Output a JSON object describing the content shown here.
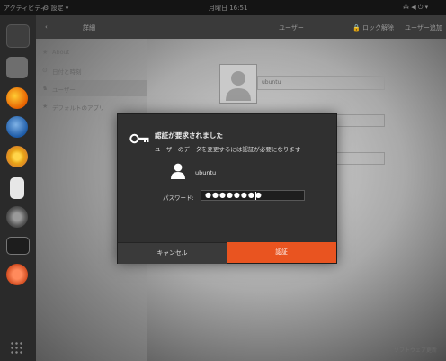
{
  "topbar": {
    "activities": "アクティビティ",
    "app_menu": "⚙ 設定 ▾",
    "clock": "月曜日 16:51",
    "status": "⁂ ◀ ⏻ ▾"
  },
  "settings_header": {
    "back": "‹",
    "section": "詳細",
    "title": "ユーザー",
    "unlock": "🔒 ロック解除",
    "add_user": "ユーザー追加"
  },
  "sidebar": {
    "items": [
      {
        "icon": "★",
        "label": "About"
      },
      {
        "icon": "⊙",
        "label": "日付と時刻"
      },
      {
        "icon": "♞",
        "label": "ユーザー"
      },
      {
        "icon": "★",
        "label": "デフォルトのアプリ"
      }
    ]
  },
  "user_panel": {
    "username": "ubuntu"
  },
  "watermark": "ソフトウェア更新",
  "dialog": {
    "title": "認証が要求されました",
    "subtitle": "ユーザーのデータを変更するには認証が必要になります",
    "user_name": "ubuntu",
    "password_label": "パスワード:",
    "password_value": "●●●●●●●●",
    "cancel_label": "キャンセル",
    "auth_label": "認証"
  },
  "colors": {
    "accent": "#e95420",
    "dialog_bg": "#303030",
    "topbar_bg": "#141414"
  },
  "dock_icons": [
    "terminal-icon",
    "text-editor-icon",
    "firefox-icon",
    "thunderbird-icon",
    "chromium-icon",
    "files-icon",
    "settings-icon",
    "monitor-icon",
    "update-icon",
    "show-apps-icon"
  ]
}
